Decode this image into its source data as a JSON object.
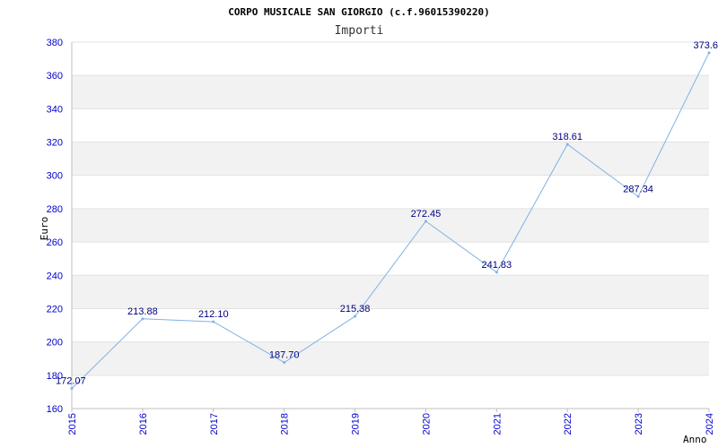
{
  "chart_data": {
    "type": "line",
    "title": "CORPO MUSICALE SAN GIORGIO (c.f.96015390220)",
    "subtitle": "Importi",
    "xlabel": "Anno",
    "ylabel": "Euro",
    "ylim": [
      160,
      380
    ],
    "y_ticks": [
      "160",
      "180",
      "200",
      "220",
      "240",
      "260",
      "280",
      "300",
      "320",
      "340",
      "360",
      "380"
    ],
    "grid": true,
    "series": [
      {
        "x": [
          "2015",
          "2016",
          "2017",
          "2018",
          "2019",
          "2020",
          "2021",
          "2022",
          "2023",
          "2024"
        ],
        "values": [
          172.07,
          213.88,
          212.1,
          187.7,
          215.38,
          272.45,
          241.83,
          318.61,
          287.34,
          373.6
        ],
        "labels": [
          "172.07",
          "213.88",
          "212.10",
          "187.70",
          "215.38",
          "272.45",
          "241.83",
          "318.61",
          "287.34",
          "373.6"
        ]
      }
    ],
    "colors": {
      "line": "#7fb2e5",
      "band": "#f2f2f2",
      "tick": "#0000cc",
      "label": "#000080"
    }
  }
}
